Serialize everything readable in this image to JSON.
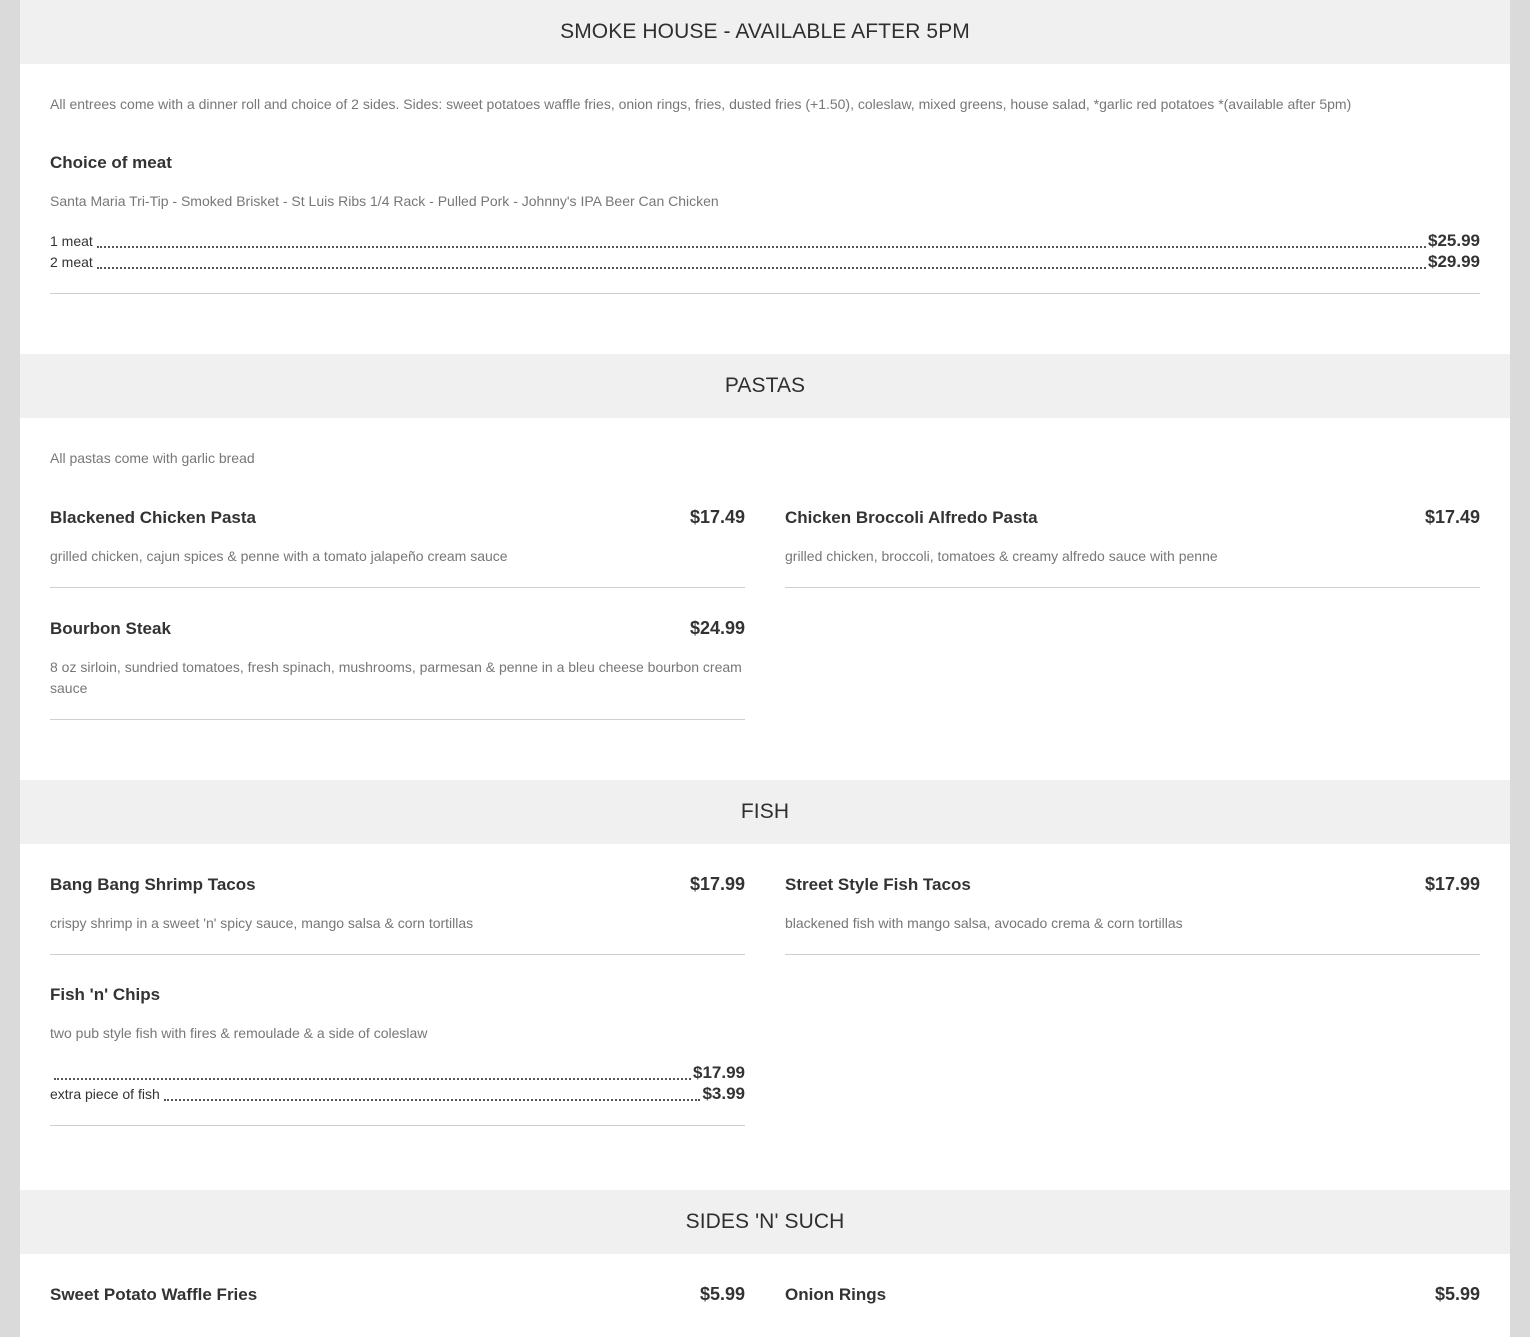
{
  "smokehouse": {
    "title": "SMOKE HOUSE - AVAILABLE AFTER 5PM",
    "note": "All entrees come with a dinner roll and choice of 2 sides. Sides: sweet potatoes waffle fries, onion rings, fries, dusted fries (+1.50), coleslaw, mixed greens, house salad, *garlic red potatoes *(available after 5pm)",
    "item": {
      "name": "Choice of meat",
      "desc": "Santa Maria Tri-Tip - Smoked Brisket - St Luis Ribs 1/4 Rack - Pulled Pork - Johnny's IPA Beer Can Chicken",
      "prices": [
        {
          "label": "1 meat",
          "price": "$25.99"
        },
        {
          "label": "2 meat",
          "price": "$29.99"
        }
      ]
    }
  },
  "pastas": {
    "title": "PASTAS",
    "note": "All pastas come with garlic bread",
    "items": [
      {
        "name": "Blackened Chicken Pasta",
        "price": "$17.49",
        "desc": "grilled chicken, cajun spices & penne with a tomato jalapeño cream sauce"
      },
      {
        "name": "Chicken Broccoli Alfredo Pasta",
        "price": "$17.49",
        "desc": "grilled chicken, broccoli, tomatoes & creamy alfredo sauce with penne"
      },
      {
        "name": "Bourbon Steak",
        "price": "$24.99",
        "desc": "8 oz sirloin, sundried tomatoes, fresh spinach, mushrooms, parmesan & penne in a bleu cheese bourbon cream sauce"
      }
    ]
  },
  "fish": {
    "title": "FISH",
    "items": [
      {
        "name": "Bang Bang Shrimp Tacos",
        "price": "$17.99",
        "desc": "crispy shrimp in a sweet 'n' spicy sauce, mango salsa & corn tortillas"
      },
      {
        "name": "Street Style Fish Tacos",
        "price": "$17.99",
        "desc": "blackened fish with mango salsa, avocado crema & corn tortillas"
      },
      {
        "name": "Fish 'n' Chips",
        "desc": "two pub style fish with fires & remoulade & a side of coleslaw",
        "prices": [
          {
            "label": "",
            "price": "$17.99"
          },
          {
            "label": "extra piece of fish",
            "price": "$3.99"
          }
        ]
      }
    ]
  },
  "sides": {
    "title": "SIDES 'N' SUCH",
    "items": [
      {
        "name": "Sweet Potato Waffle Fries",
        "price": "$5.99"
      },
      {
        "name": "Onion Rings",
        "price": "$5.99"
      }
    ]
  }
}
